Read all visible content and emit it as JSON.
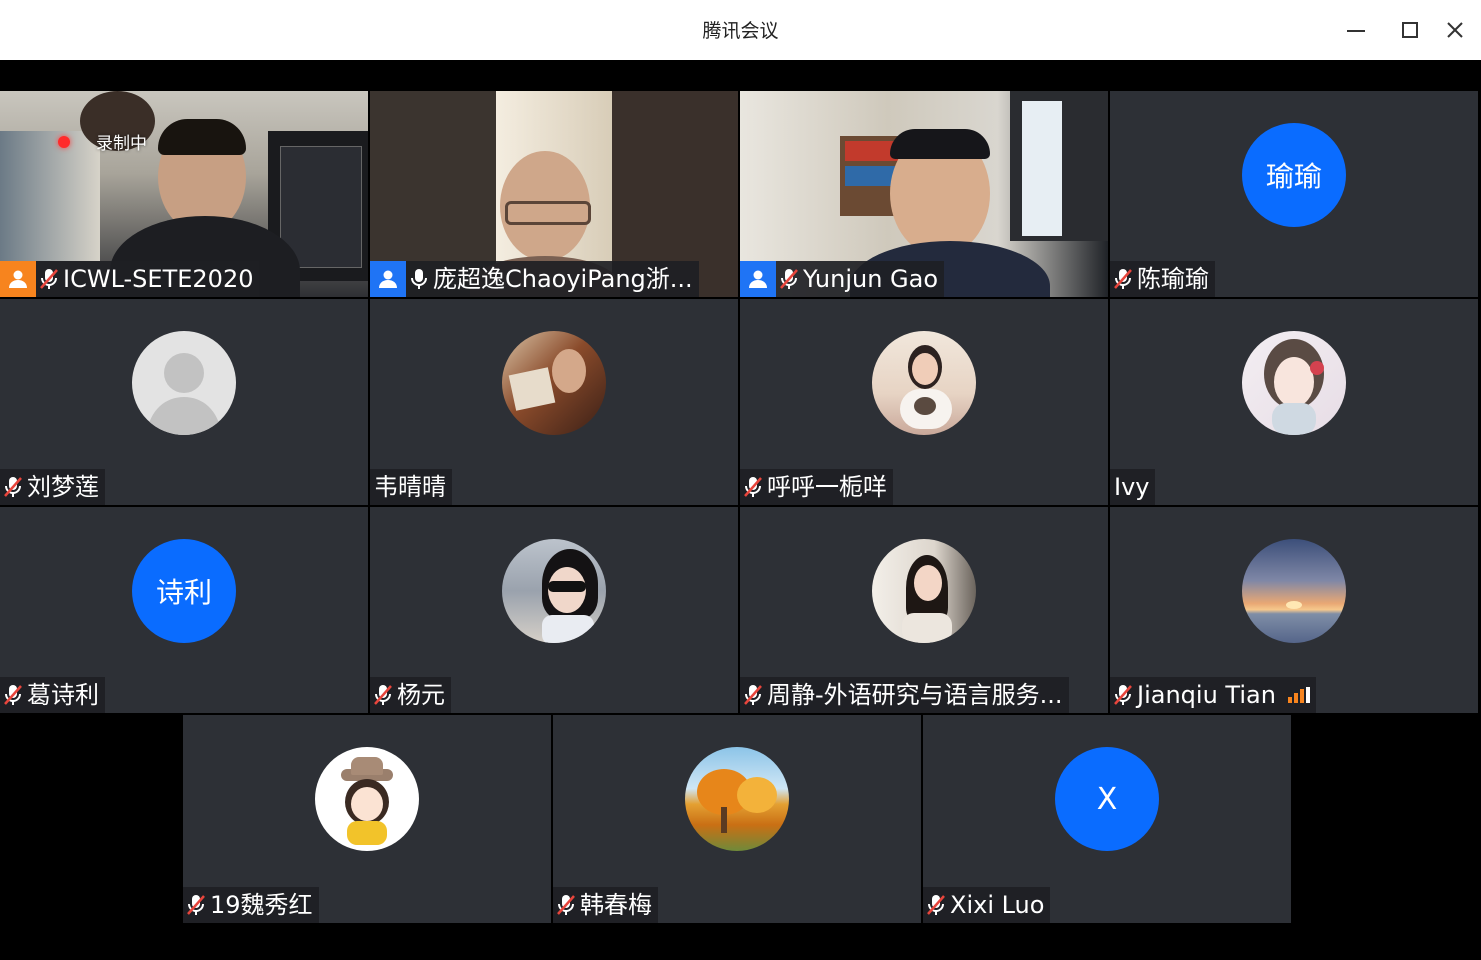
{
  "window": {
    "title": "腾讯会议",
    "controls": {
      "minimize_icon": "minimize-icon",
      "maximize_icon": "maximize-icon",
      "close_icon": "close-icon"
    }
  },
  "recording": {
    "label": "录制中"
  },
  "colors": {
    "avatar_blue": "#0a6cff",
    "host_orange": "#f7841e",
    "host_blue": "#1f74f5",
    "tile_bg": "#2d3036"
  },
  "participants": [
    {
      "name": "ICWL-SETE2020",
      "mic": "muted",
      "host_badge": "orange",
      "media": "video"
    },
    {
      "name": "庞超逸ChaoyiPang浙...",
      "mic": "on",
      "host_badge": "blue",
      "media": "video"
    },
    {
      "name": "Yunjun Gao",
      "mic": "muted",
      "host_badge": "blue",
      "media": "video"
    },
    {
      "name": "陈瑜瑜",
      "mic": "muted",
      "avatar_text": "瑜瑜"
    },
    {
      "name": "刘梦莲",
      "mic": "muted",
      "avatar": "default-person-avatar"
    },
    {
      "name": "韦晴晴",
      "mic": "none",
      "avatar": "portrait-reading-avatar"
    },
    {
      "name": "呼呼一栀咩",
      "mic": "muted",
      "avatar": "girl-with-dog-avatar"
    },
    {
      "name": "Ivy",
      "mic": "none",
      "avatar": "anime-girl-avatar"
    },
    {
      "name": "葛诗利",
      "mic": "muted",
      "avatar_text": "诗利"
    },
    {
      "name": "杨元",
      "mic": "muted",
      "avatar": "sunglasses-woman-avatar"
    },
    {
      "name": "周静-外语研究与语言服务...",
      "mic": "muted",
      "avatar": "young-woman-avatar"
    },
    {
      "name": "Jianqiu Tian",
      "mic": "muted",
      "avatar": "sunset-sea-avatar",
      "signal_icon": "signal-bars-icon"
    },
    {
      "name": "19魏秀红",
      "mic": "muted",
      "avatar": "cartoon-girl-hat-avatar"
    },
    {
      "name": "韩春梅",
      "mic": "muted",
      "avatar": "autumn-tree-avatar"
    },
    {
      "name": "Xixi Luo",
      "mic": "muted",
      "avatar_text": "X"
    }
  ]
}
